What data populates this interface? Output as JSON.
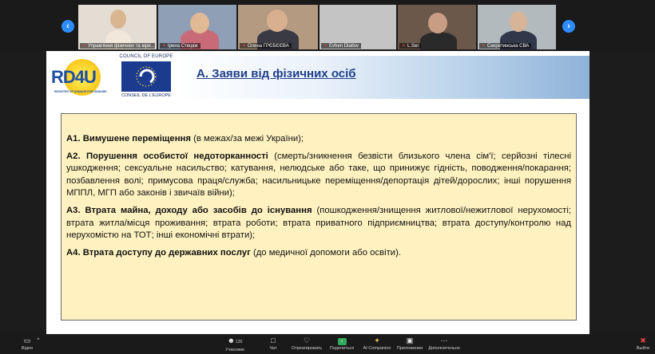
{
  "gallery": {
    "prev_arrow": "‹",
    "next_arrow": "›",
    "tiles": [
      {
        "name": "Управління фізичних та юри...",
        "bg": "#d8cfc6"
      },
      {
        "name": "Ірина Стецюк",
        "bg": "#7d8fa8"
      },
      {
        "name": "Олена ГРЄБЄЄВА",
        "bg": "#a89279"
      },
      {
        "name": "Evhen Diatlov",
        "bg": "#bcbcbc"
      },
      {
        "name": "L.Ser",
        "bg": "#6f5c4f"
      },
      {
        "name": "Скеретинська СВА",
        "bg": "#aab2b6"
      }
    ]
  },
  "slide": {
    "logo_rd4u": "RD4U",
    "logo_rd4u_sub": "REGISTER OF DAMAGE FOR UKRAINE",
    "coe_top": "COUNCIL OF EUROPE",
    "coe_bottom": "CONSEIL DE L'EUROPE",
    "title": "А. Заяви від фізичних осіб",
    "items": [
      {
        "head": "А1. Вимушене переміщення",
        "body": " (в межах/за межі України);"
      },
      {
        "head": "А2. Порушення особистої недоторканності",
        "body": " (смерть/зникнення безвісти близького члена сім'ї; серйозні тілесні ушкодження; сексуальне насильство; катування, нелюдське або таке, що принижує гідність, поводження/покарання; позбавлення волі; примусова праця/служба; насильницьке переміщення/депортація дітей/дорослих; інші порушення МППЛ, МГП або законів і звичаїв війни);"
      },
      {
        "head": "А3. Втрата майна, доходу або засобів до існування",
        "body": " (пошкодження/знищення житлової/нежитлової нерухомості; втрата житла/місця проживання; втрата роботи; втрата приватного підприємництва; втрата доступу/контролю над нерухомістю на ТОТ; інші економічні втрати);"
      },
      {
        "head": "А4. Втрата доступу до державних послуг",
        "body": " (до медичної допомоги або освіти)."
      }
    ]
  },
  "toolbar": {
    "video": {
      "icon": "video-icon",
      "label": "Відео",
      "chevron": "^"
    },
    "participants": {
      "icon": "participants-icon",
      "label": "Учасники",
      "count": "130"
    },
    "chat": {
      "icon": "chat-icon",
      "label": "Чат"
    },
    "react": {
      "icon": "react-icon",
      "label": "Отреагировать"
    },
    "share": {
      "icon": "share-icon",
      "label": "Поделиться"
    },
    "ai": {
      "icon": "ai-companion-icon",
      "label": "AI Companion"
    },
    "apps": {
      "icon": "apps-icon",
      "label": "Приложения"
    },
    "more": {
      "icon": "more-icon",
      "label": "Дополнительно"
    },
    "leave": {
      "icon": "leave-icon",
      "label": "Выйти"
    }
  }
}
